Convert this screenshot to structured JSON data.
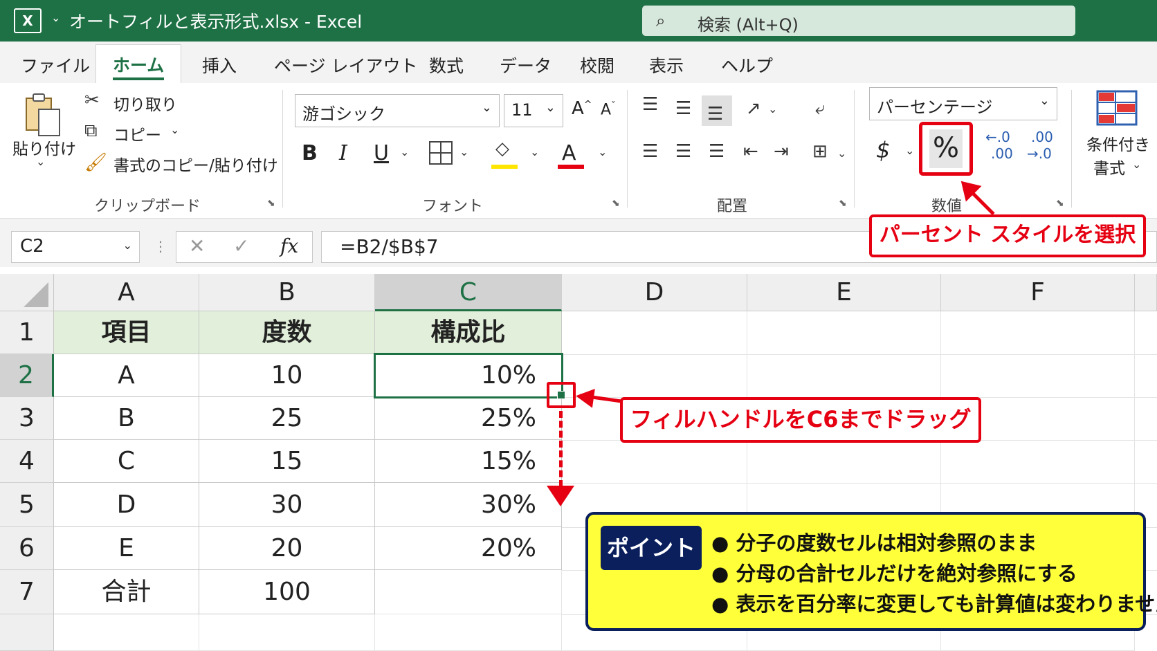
{
  "titlebar": {
    "app_icon": "X",
    "caret": "⌄",
    "title": "オートフィルと表示形式.xlsx  -  Excel",
    "search_placeholder": "検索 (Alt+Q)"
  },
  "tabs": [
    "ファイル",
    "ホーム",
    "挿入",
    "ページ レイアウト",
    "数式",
    "データ",
    "校閲",
    "表示",
    "ヘルプ"
  ],
  "active_tab": "ホーム",
  "clipboard": {
    "paste": "貼り付け",
    "cut": "切り取り",
    "copy": "コピー",
    "format_painter": "書式のコピー/貼り付け",
    "group": "クリップボード"
  },
  "font": {
    "name": "游ゴシック",
    "size": "11",
    "grow": "A",
    "shrink": "A",
    "bold": "B",
    "italic": "I",
    "underline": "U",
    "font_color": "A",
    "group": "フォント"
  },
  "alignment": {
    "group": "配置"
  },
  "number": {
    "format": "パーセンテージ",
    "currency": "$",
    "percent": "%",
    "inc_decimal_top": ".0",
    "inc_decimal_bottom": ".00",
    "dec_decimal_top": ".00",
    "dec_decimal_bottom": ".0",
    "group": "数値"
  },
  "styles": {
    "conditional_line1": "条件付き",
    "conditional_line2": "書式"
  },
  "formula_bar": {
    "name_box": "C2",
    "fx": "fx",
    "formula": "=B2/$B$7"
  },
  "columns": [
    "A",
    "B",
    "C",
    "D",
    "E",
    "F"
  ],
  "rows": [
    "1",
    "2",
    "3",
    "4",
    "5",
    "6",
    "7"
  ],
  "table": {
    "headers": [
      "項目",
      "度数",
      "構成比"
    ],
    "data": [
      [
        "A",
        "10",
        "10%"
      ],
      [
        "B",
        "25",
        "25%"
      ],
      [
        "C",
        "15",
        "15%"
      ],
      [
        "D",
        "30",
        "30%"
      ],
      [
        "E",
        "20",
        "20%"
      ],
      [
        "合計",
        "100",
        ""
      ]
    ]
  },
  "callouts": {
    "percent_style": "パーセント スタイルを選択",
    "fill_handle": "フィルハンドルをC6までドラッグ"
  },
  "point": {
    "tag": "ポイント",
    "bullets": [
      "● 分子の度数セルは相対参照のまま",
      "● 分母の合計セルだけを絶対参照にする",
      "● 表示を百分率に変更しても計算値は変わりません"
    ]
  },
  "colors": {
    "excel_green": "#1e7145",
    "header_fill": "#e2efda",
    "callout_red": "#e50012",
    "point_yellow": "#ffff3a",
    "point_navy": "#0a1f5c"
  }
}
